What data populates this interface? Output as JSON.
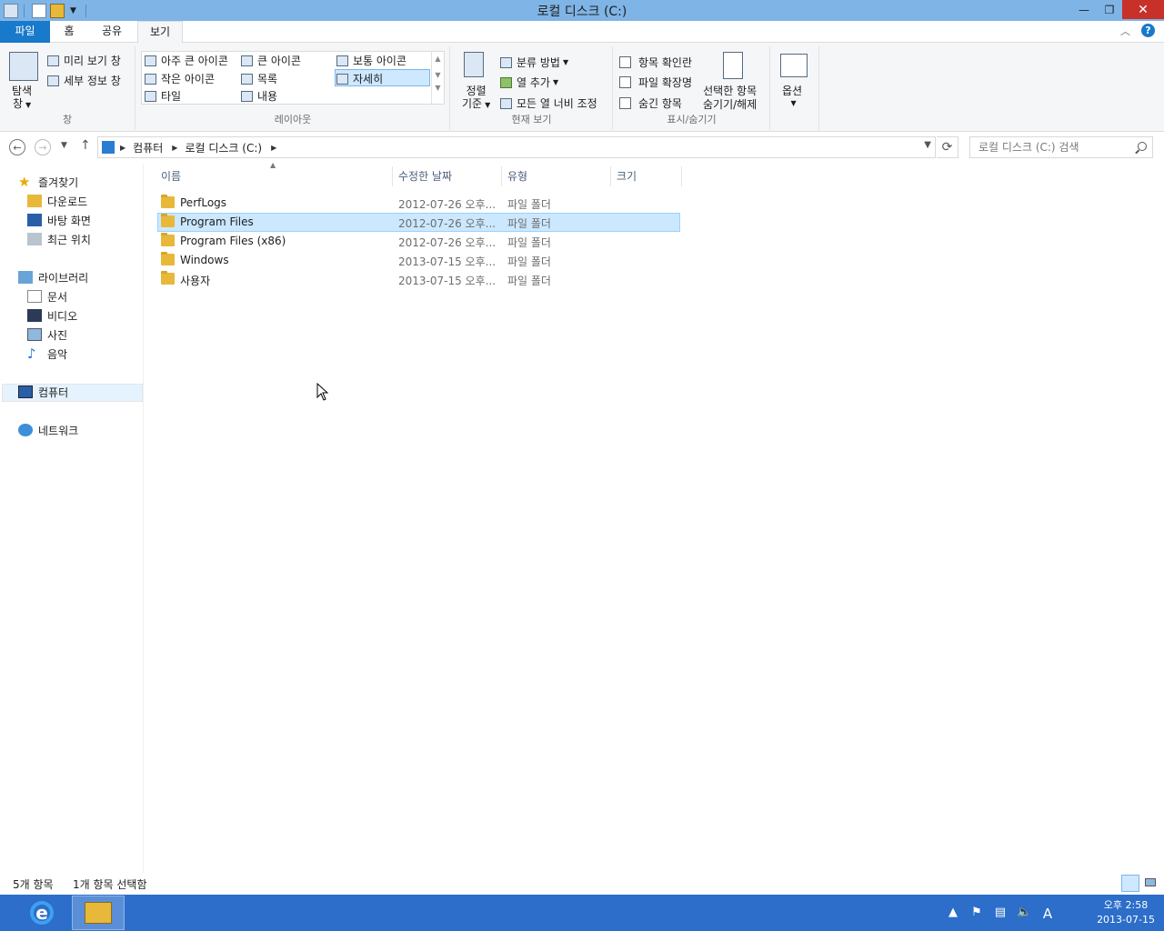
{
  "window": {
    "title": "로컬 디스크 (C:)"
  },
  "ribbon_tabs": {
    "file": "파일",
    "home": "홈",
    "share": "공유",
    "view": "보기"
  },
  "ribbon": {
    "pane_group": {
      "nav_pane_line1": "탐색",
      "nav_pane_line2": "창",
      "preview_pane": "미리 보기 창",
      "details_pane": "세부 정보 창",
      "label": "창"
    },
    "layout_group": {
      "extra_large_icons": "아주 큰 아이콘",
      "large_icons": "큰 아이콘",
      "medium_icons": "보통 아이콘",
      "small_icons": "작은 아이콘",
      "list": "목록",
      "details": "자세히",
      "tiles": "타일",
      "content": "내용",
      "label": "레이아웃"
    },
    "current_view_group": {
      "sort_by_line1": "정렬",
      "sort_by_line2": "기준",
      "group_by": "분류 방법",
      "add_columns": "열 추가",
      "size_all_columns": "모든 열 너비 조정",
      "label": "현재 보기"
    },
    "show_hide_group": {
      "item_checkboxes": "항목 확인란",
      "file_extensions": "파일 확장명",
      "hidden_items": "숨긴 항목",
      "hide_selected_line1": "선택한 항목",
      "hide_selected_line2": "숨기기/해제",
      "label": "표시/숨기기"
    },
    "options": {
      "label": "옵션"
    }
  },
  "address": {
    "crumbs": [
      "컴퓨터",
      "로컬 디스크 (C:)"
    ],
    "search_placeholder": "로컬 디스크 (C:) 검색"
  },
  "nav_pane": {
    "favorites": "즐겨찾기",
    "downloads": "다운로드",
    "desktop": "바탕 화면",
    "recent": "최근 위치",
    "libraries": "라이브러리",
    "documents": "문서",
    "videos": "비디오",
    "pictures": "사진",
    "music": "음악",
    "computer": "컴퓨터",
    "network": "네트워크"
  },
  "columns": {
    "name": "이름",
    "date": "수정한 날짜",
    "type": "유형",
    "size": "크기"
  },
  "files": [
    {
      "name": "PerfLogs",
      "date": "2012-07-26 오후...",
      "type": "파일 폴더",
      "size": ""
    },
    {
      "name": "Program Files",
      "date": "2012-07-26 오후...",
      "type": "파일 폴더",
      "size": ""
    },
    {
      "name": "Program Files (x86)",
      "date": "2012-07-26 오후...",
      "type": "파일 폴더",
      "size": ""
    },
    {
      "name": "Windows",
      "date": "2013-07-15 오후...",
      "type": "파일 폴더",
      "size": ""
    },
    {
      "name": "사용자",
      "date": "2013-07-15 오후...",
      "type": "파일 폴더",
      "size": ""
    }
  ],
  "selected_index": 1,
  "status": {
    "item_count": "5개 항목",
    "selected": "1개 항목 선택함"
  },
  "taskbar": {
    "time": "오후 2:58",
    "date": "2013-07-15",
    "ime": "A"
  },
  "colors": {
    "titlebar": "#7fb4e6",
    "file_tab": "#1979ca",
    "selection": "#cce8ff",
    "taskbar": "#2c6ec9",
    "close": "#c7312a"
  }
}
